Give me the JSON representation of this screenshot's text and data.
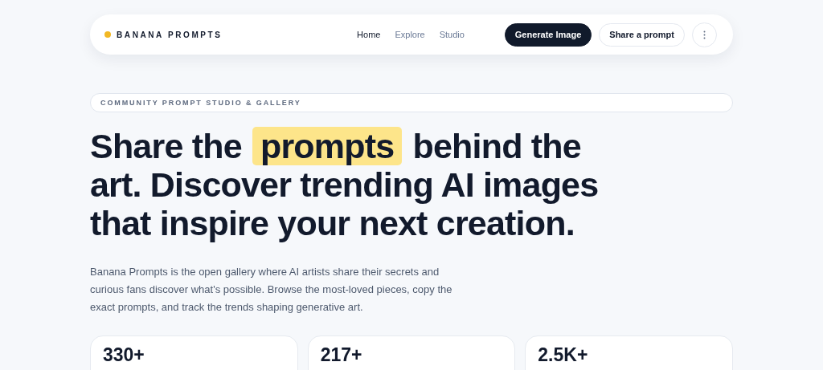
{
  "brand": {
    "name": "BANANA PROMPTS"
  },
  "nav": [
    {
      "label": "Home",
      "selected": true
    },
    {
      "label": "Explore",
      "selected": false
    },
    {
      "label": "Studio",
      "selected": false
    }
  ],
  "actions": {
    "primary": "Generate Image",
    "secondary": "Share a prompt"
  },
  "eyebrow": "COMMUNITY PROMPT STUDIO & GALLERY",
  "headline": {
    "before": "Share the",
    "highlight": "prompts",
    "after": "behind the",
    "lines": [
      "art. Discover trending AI images",
      "that inspire your next creation."
    ]
  },
  "intro": "Banana Prompts is the open gallery where AI artists share their secrets and curious fans discover what's possible. Browse the most-loved pieces, copy the exact prompts, and track the trends shaping generative art.",
  "stats": [
    {
      "value": "330+"
    },
    {
      "value": "217+"
    },
    {
      "value": "2.5K+"
    }
  ]
}
